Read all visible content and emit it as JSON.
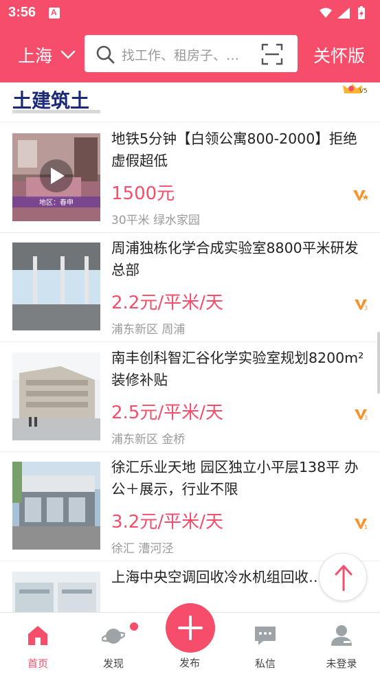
{
  "status_bar": {
    "time": "3:56"
  },
  "header": {
    "city": "上海",
    "search_placeholder": "找工作、租房子、…",
    "care_mode": "关怀版"
  },
  "banner": {
    "text": "土建筑土",
    "badge": "V5"
  },
  "listings": [
    {
      "title": "地铁5分钟【白领公寓800-2000】拒绝虚假超低",
      "price": "1500元",
      "location": "30平米 绿水家园",
      "thumb_caption": "地区：春申",
      "badge": "V",
      "has_video": true
    },
    {
      "title": "周浦独栋化学合成实验室8800平米研发总部",
      "price": "2.2元/平米/天",
      "location": "浦东新区 周浦",
      "badge": "V3"
    },
    {
      "title": "南丰创科智汇谷化学实验室规划8200m²装修补贴",
      "price": "2.5元/平米/天",
      "location": "浦东新区 金桥",
      "badge": "V3"
    },
    {
      "title": "徐汇乐业天地 园区独立小平层138平 办公＋展示，行业不限",
      "price": "3.2元/平米/天",
      "location": "徐汇 漕河泾",
      "badge": "V1"
    },
    {
      "title": "上海中央空调回收冷水机组回收…调回收",
      "price": "",
      "location": ""
    }
  ],
  "tabs": {
    "home": "首页",
    "discover": "发现",
    "publish": "发布",
    "messages": "私信",
    "login": "未登录"
  },
  "colors": {
    "brand": "#f54d6a",
    "badge_orange": "#f7932e"
  }
}
